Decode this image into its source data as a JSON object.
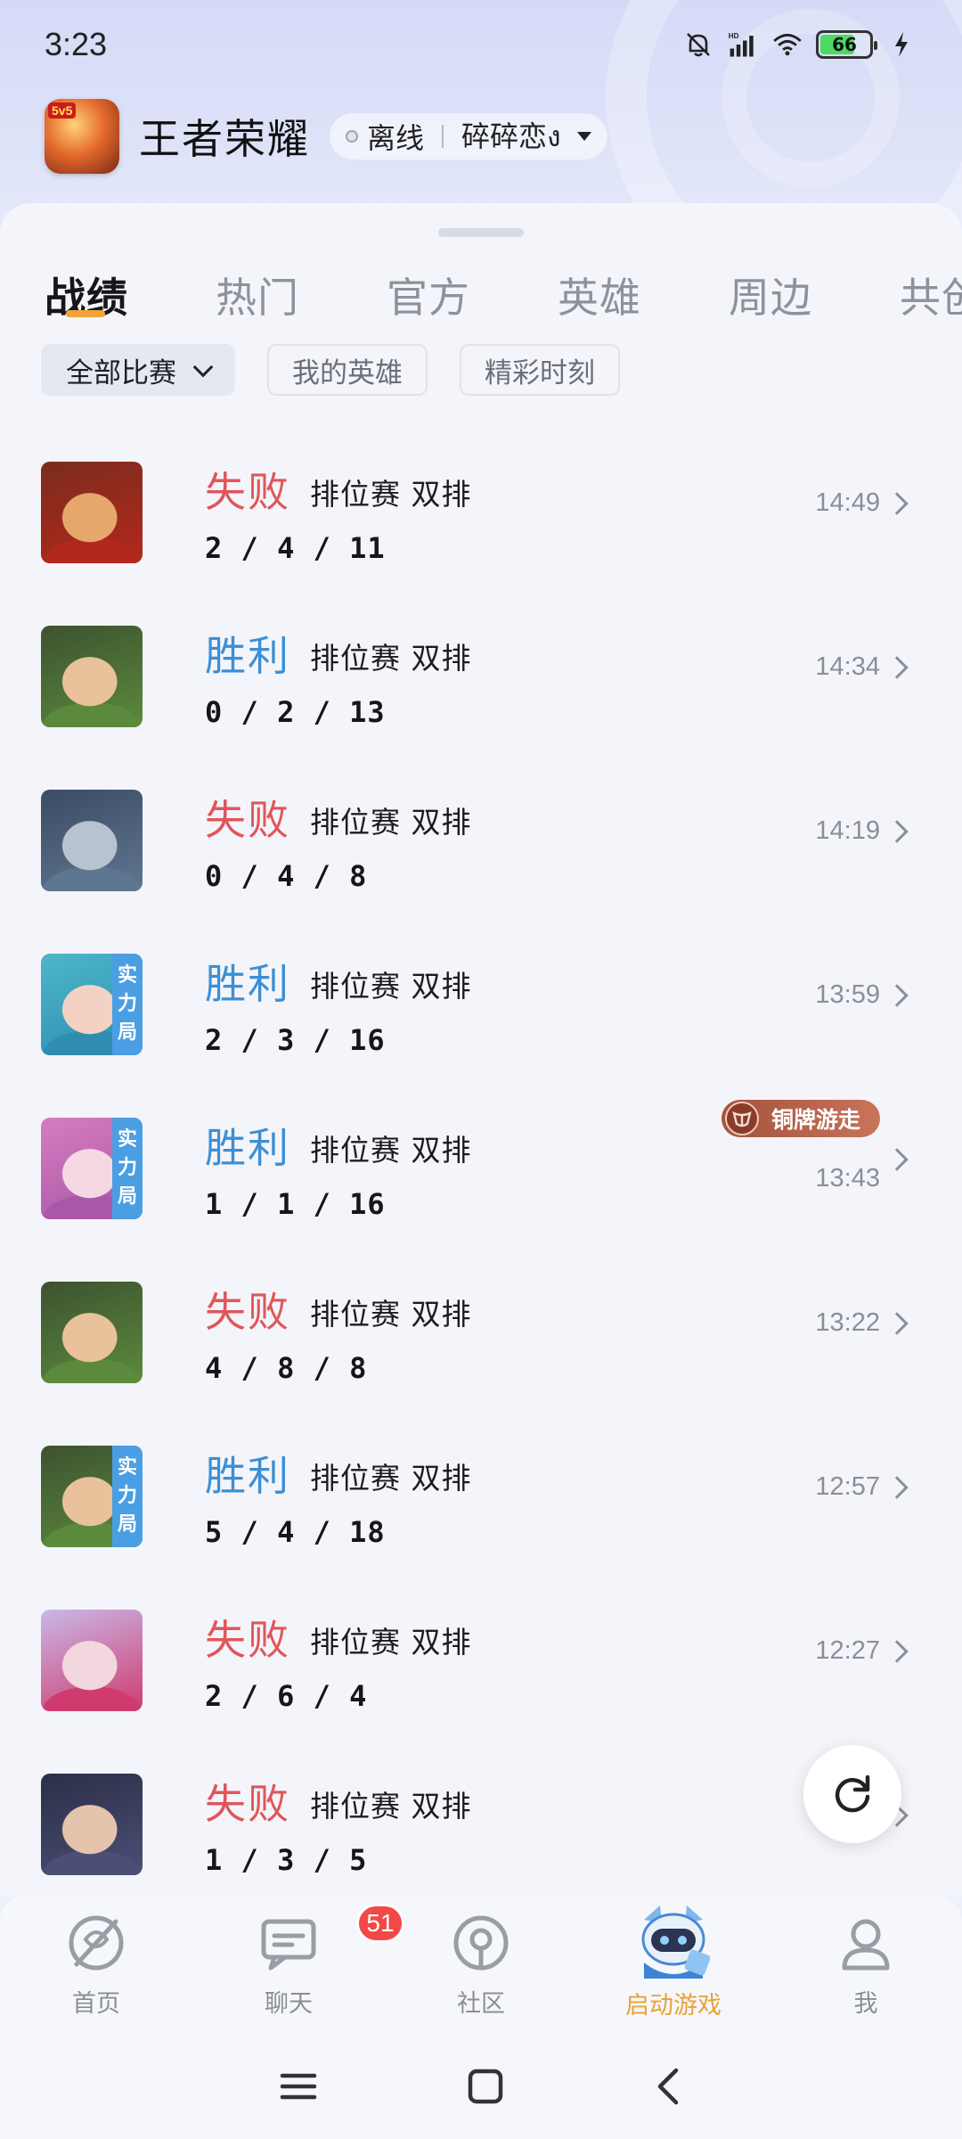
{
  "status_bar": {
    "time": "3:23",
    "battery": "66"
  },
  "header": {
    "app_name": "王者荣耀",
    "game_icon_tag": "5v5",
    "status": "离线",
    "player_name": "碎碎恋ง"
  },
  "tabs": [
    {
      "label": "战绩",
      "active": true
    },
    {
      "label": "热门"
    },
    {
      "label": "官方"
    },
    {
      "label": "英雄"
    },
    {
      "label": "周边"
    },
    {
      "label": "共创"
    }
  ],
  "filters": [
    {
      "label": "全部比赛",
      "selected": true
    },
    {
      "label": "我的英雄"
    },
    {
      "label": "精彩时刻"
    }
  ],
  "matches": [
    {
      "result": "失败",
      "type": "lose",
      "mode": "排位赛 双排",
      "kda": "2 / 4 / 11",
      "time": "14:49",
      "badge": false,
      "colors": [
        "#7a2c1d",
        "#e6a66c",
        "#b3281c"
      ]
    },
    {
      "result": "胜利",
      "type": "win",
      "mode": "排位赛 双排",
      "kda": "0 / 2 / 13",
      "time": "14:34",
      "badge": false,
      "colors": [
        "#3d5230",
        "#e9c29c",
        "#5c8a3c"
      ]
    },
    {
      "result": "失败",
      "type": "lose",
      "mode": "排位赛 双排",
      "kda": "0 / 4 / 8",
      "time": "14:19",
      "badge": false,
      "colors": [
        "#3b4c63",
        "#b9c3cf",
        "#5f7691"
      ]
    },
    {
      "result": "胜利",
      "type": "win",
      "mode": "排位赛 双排",
      "kda": "2 / 3 / 16",
      "time": "13:59",
      "badge": true,
      "colors": [
        "#4db6c9",
        "#f3d2c4",
        "#2f8db1"
      ]
    },
    {
      "result": "胜利",
      "type": "win",
      "mode": "排位赛 双排",
      "kda": "1 / 1 / 16",
      "time": "13:43",
      "badge": true,
      "honor": "铜牌游走",
      "colors": [
        "#d67cc0",
        "#f6d8e4",
        "#a957a8"
      ]
    },
    {
      "result": "失败",
      "type": "lose",
      "mode": "排位赛 双排",
      "kda": "4 / 8 / 8",
      "time": "13:22",
      "badge": false,
      "colors": [
        "#3d5230",
        "#e9c29c",
        "#5c8a3c"
      ]
    },
    {
      "result": "胜利",
      "type": "win",
      "mode": "排位赛 双排",
      "kda": "5 / 4 / 18",
      "time": "12:57",
      "badge": true,
      "colors": [
        "#3d5230",
        "#e9c29c",
        "#5c8a3c"
      ]
    },
    {
      "result": "失败",
      "type": "lose",
      "mode": "排位赛 双排",
      "kda": "2 / 6 / 4",
      "time": "12:27",
      "badge": false,
      "colors": [
        "#c9b8e6",
        "#f3d7df",
        "#cf3b6f"
      ]
    },
    {
      "result": "失败",
      "type": "lose",
      "mode": "排位赛 双排",
      "kda": "1 / 3 / 5",
      "time": "",
      "badge": false,
      "colors": [
        "#2b2f47",
        "#e6c3ad",
        "#4b4f75"
      ]
    }
  ],
  "badge_text": [
    "实",
    "力",
    "局"
  ],
  "bottom_nav": [
    {
      "label": "首页",
      "icon": "home-icon"
    },
    {
      "label": "聊天",
      "icon": "chat-icon",
      "count": "51"
    },
    {
      "label": "社区",
      "icon": "community-icon"
    },
    {
      "label": "启动游戏",
      "icon": "launch-game-icon"
    },
    {
      "label": "我",
      "icon": "profile-icon"
    }
  ],
  "colors": {
    "accent": "#f1a43a",
    "win": "#3d8fd4",
    "lose": "#e0565a",
    "badge": "#4a9ee3",
    "notif": "#f24848"
  }
}
